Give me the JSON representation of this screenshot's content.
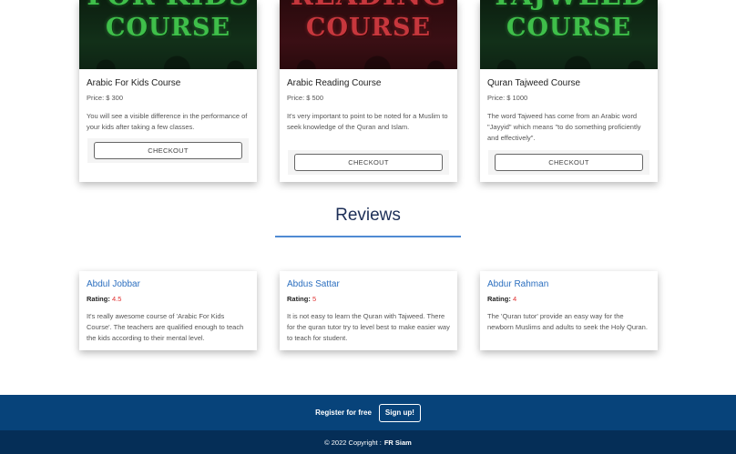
{
  "courses": [
    {
      "banner_top": "FOR KIDS",
      "banner_main": "COURSE",
      "banner_color": "#3fbf4a",
      "title": "Arabic For Kids Course",
      "price": "Price: $ 300",
      "description": "You will see a visible difference in the performance of your kids after taking a few classes.",
      "checkout_label": "CHECKOUT"
    },
    {
      "banner_top": "READING",
      "banner_main": "COURSE",
      "banner_color": "#c7373d",
      "title": "Arabic Reading Course",
      "price": "Price: $ 500",
      "description": "It's very important to point to be noted for a Muslim to seek knowledge of the Quran and Islam.",
      "checkout_label": "CHECKOUT"
    },
    {
      "banner_top": "TAJWEED",
      "banner_main": "COURSE",
      "banner_color": "#3fbf4a",
      "title": "Quran Tajweed Course",
      "price": "Price: $ 1000",
      "description": "The word Tajweed has come from an Arabic word \"Jayyid\" which means \"to do something proficiently and effectively\".",
      "checkout_label": "CHECKOUT"
    }
  ],
  "reviews_section": {
    "heading": "Reviews",
    "accent_color": "#4f8ad3",
    "items": [
      {
        "name": "Abdul Jobbar",
        "rating_label": "Rating:",
        "rating": "4.5",
        "text": "It's really awesome course of 'Arabic For Kids Course'. The teachers are qualified enough to teach the kids according to their mental level."
      },
      {
        "name": "Abdus Sattar",
        "rating_label": "Rating:",
        "rating": "5",
        "text": "It is not easy to learn the Quran with Tajweed. There for the quran tutor try to level best to make easier way to teach for student."
      },
      {
        "name": "Abdur Rahman",
        "rating_label": "Rating:",
        "rating": "4",
        "text": "The 'Quran tutor' provide an easy way for the newborn Muslims and adults to seek the Holy Quran."
      }
    ]
  },
  "footer": {
    "register_text": "Register for free",
    "signup_label": "Sign up!",
    "copyright_text": "© 2022 Copyright :",
    "copyright_owner": "FR Siam",
    "bg_color": "#07437a"
  }
}
